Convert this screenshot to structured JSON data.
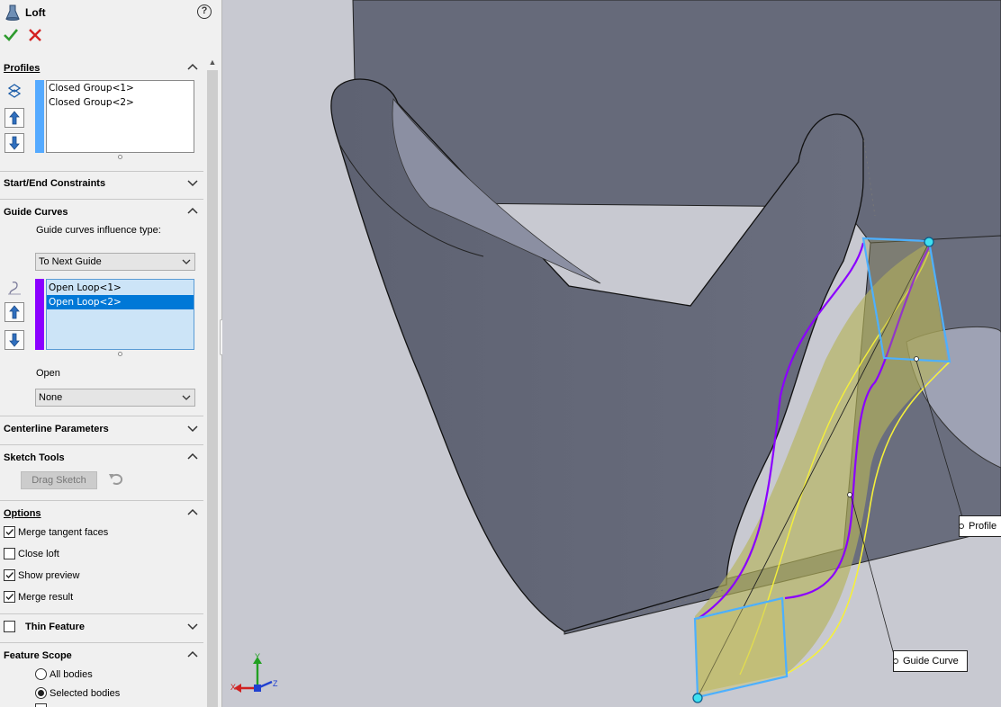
{
  "panel": {
    "title": "Loft",
    "help_symbol": "?",
    "ok_icon": "check-icon",
    "cancel_icon": "x-icon"
  },
  "profiles": {
    "header": "Profiles",
    "items": [
      "Closed Group<1>",
      "Closed Group<2>"
    ],
    "color": "#55aaff"
  },
  "start_end": {
    "header": "Start/End Constraints"
  },
  "guide_curves": {
    "header": "Guide Curves",
    "influence_label": "Guide curves influence type:",
    "influence_value": "To Next Guide",
    "items": [
      "Open Loop<1>",
      "Open Loop<2>"
    ],
    "selected_index": 1,
    "color": "#8b00ff",
    "open_label": "Open",
    "open_value": "None"
  },
  "centerline": {
    "header": "Centerline Parameters"
  },
  "sketch_tools": {
    "header": "Sketch Tools",
    "drag_sketch": "Drag Sketch"
  },
  "options": {
    "header": "Options",
    "merge_tangent": {
      "label": "Merge tangent faces",
      "checked": true
    },
    "close_loft": {
      "label": "Close loft",
      "checked": false
    },
    "show_preview": {
      "label": "Show preview",
      "checked": true
    },
    "merge_result": {
      "label": "Merge result",
      "checked": true
    }
  },
  "thin_feature": {
    "header": "Thin Feature",
    "checked": false
  },
  "feature_scope": {
    "header": "Feature Scope",
    "all_bodies": "All bodies",
    "selected_bodies": "Selected bodies",
    "selected": "selected_bodies"
  },
  "viewport": {
    "callout_profile": "Profile",
    "callout_guide": "Guide Curve",
    "triad": {
      "x": "X",
      "y": "Y",
      "z": "Z"
    }
  }
}
